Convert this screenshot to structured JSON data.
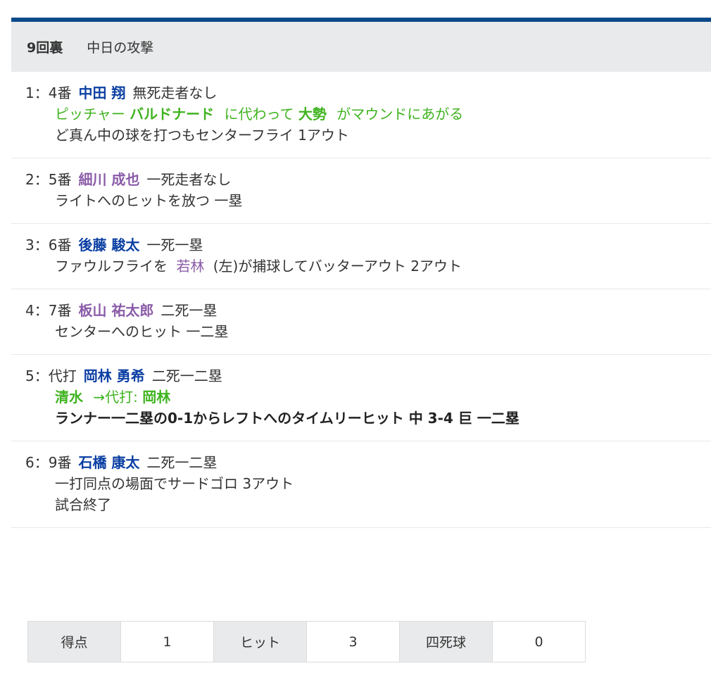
{
  "header": {
    "inning": "9回裏",
    "team_attack": "中日の攻撃"
  },
  "plays": [
    {
      "num": "1：4番",
      "player": "中田 翔",
      "situation": "無死走者なし",
      "sub_green_pre": "ピッチャー",
      "sub_green_b1": "バルドナード",
      "sub_green_mid": "に代わって",
      "sub_green_b2": "大勢",
      "sub_green_post": "がマウンドにあがる",
      "result": "ど真ん中の球を打つもセンターフライ 1アウト"
    },
    {
      "num": "2：5番",
      "player": "細川 成也",
      "situation": "一死走者なし",
      "result": "ライトへのヒットを放つ 一塁"
    },
    {
      "num": "3：6番",
      "player": "後藤 駿太",
      "situation": "一死一塁",
      "result_pre": "ファウルフライを",
      "fielder": "若林",
      "result_post": "(左)が捕球してバッターアウト 2アウト"
    },
    {
      "num": "4：7番",
      "player": "板山 祐太郎",
      "situation": "二死一塁",
      "result": "センターへのヒット 一二塁"
    },
    {
      "num": "5：代打",
      "player": "岡林 勇希",
      "situation": "二死一二塁",
      "sub_green_b1": "清水",
      "sub_green_mid": "→代打:",
      "sub_green_b2": "岡林",
      "result": "ランナー一二塁の0-1からレフトへのタイムリーヒット 中 3-4 巨 一二塁"
    },
    {
      "num": "6：9番",
      "player": "石橋 康太",
      "situation": "二死一二塁",
      "result": "一打同点の場面でサードゴロ 3アウト",
      "result2": "試合終了"
    }
  ],
  "stats": {
    "runs_label": "得点",
    "runs": "1",
    "hits_label": "ヒット",
    "hits": "3",
    "walks_label": "四死球",
    "walks": "0"
  },
  "colors": {
    "topbar": "#0b4a8a",
    "blue_player": "#0b3fa3",
    "purple_player": "#8a5ca8",
    "green": "#3fb31f"
  }
}
